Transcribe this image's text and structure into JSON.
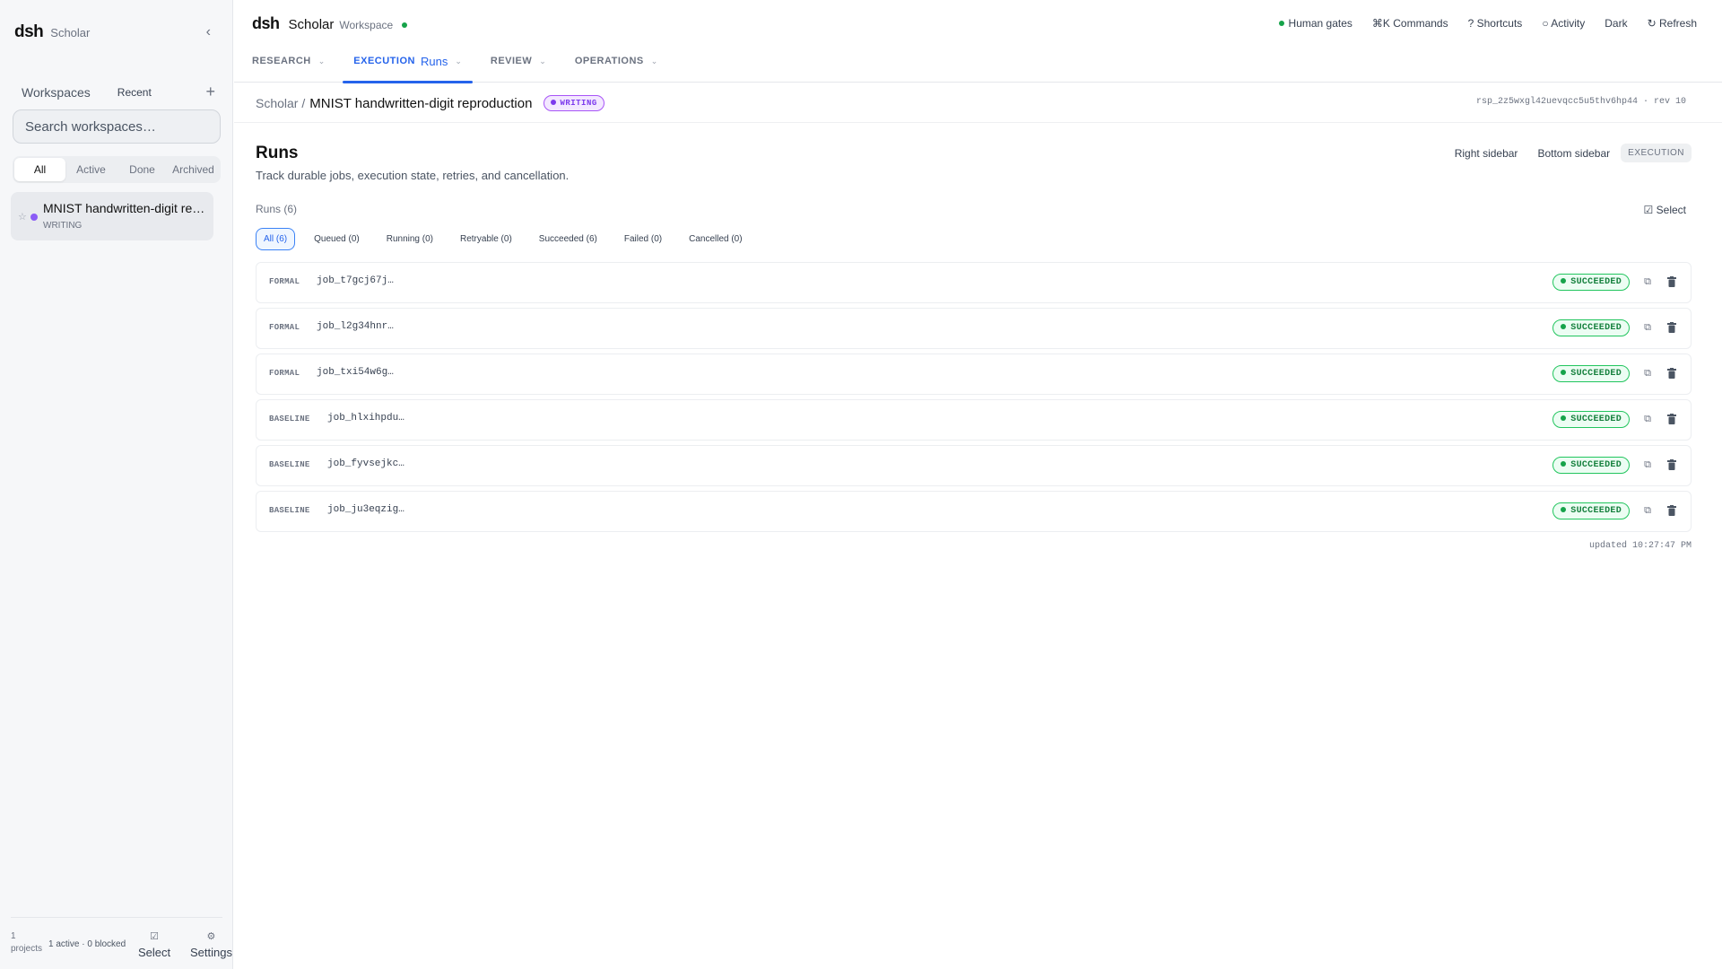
{
  "sidebar": {
    "brand": "dsh",
    "brand_sub": "Scholar",
    "collapse_icon": "‹",
    "workspaces_label": "Workspaces",
    "recent_label": "Recent",
    "add_icon": "+",
    "search_placeholder": "Search workspaces…",
    "filters": [
      "All",
      "Active",
      "Done",
      "Archived"
    ],
    "active_filter": "All",
    "project": {
      "star": "☆",
      "name": "MNIST handwritten-digit reproduction",
      "status": "WRITING",
      "dot_color": "#8b5cf6"
    },
    "footer": {
      "projects_count": "1",
      "projects_label": "projects",
      "status": "1 active · 0 blocked",
      "select_icon": "☑",
      "select_label": "Select",
      "settings_icon": "⚙",
      "settings_label": "Settings"
    }
  },
  "topbar": {
    "brand": "dsh",
    "app": "Scholar",
    "context": "Workspace",
    "actions": {
      "human_gates": "Human gates",
      "commands": "⌘K Commands",
      "shortcuts": "? Shortcuts",
      "activity": "○ Activity",
      "theme": "Dark",
      "refresh": "↻ Refresh"
    },
    "nav": [
      {
        "label": "RESEARCH",
        "sub": ""
      },
      {
        "label": "EXECUTION",
        "sub": "Runs"
      },
      {
        "label": "REVIEW",
        "sub": ""
      },
      {
        "label": "OPERATIONS",
        "sub": ""
      }
    ],
    "chevron": "⌄"
  },
  "crumb": {
    "root": "Scholar /",
    "page": "MNIST handwritten-digit reproduction",
    "badge": "WRITING",
    "id": "rsp_2z5wxgl42uevqcc5u5thv6hp44 · rev 10"
  },
  "main": {
    "title": "Runs",
    "description": "Track durable jobs, execution state, retries, and cancellation.",
    "right_sidebar": "Right sidebar",
    "bottom_sidebar": "Bottom sidebar",
    "section_pill": "EXECUTION",
    "runs_count": "Runs (6)",
    "select": "☑ Select",
    "filters": [
      "All (6)",
      "Queued (0)",
      "Running (0)",
      "Retryable (0)",
      "Succeeded (6)",
      "Failed (0)",
      "Cancelled (0)"
    ],
    "runs": [
      {
        "kind": "FORMAL",
        "id": "job_t7gcj67j…",
        "status": "SUCCEEDED"
      },
      {
        "kind": "FORMAL",
        "id": "job_l2g34hnr…",
        "status": "SUCCEEDED"
      },
      {
        "kind": "FORMAL",
        "id": "job_txi54w6g…",
        "status": "SUCCEEDED"
      },
      {
        "kind": "BASELINE",
        "id": "job_hlxihpdu…",
        "status": "SUCCEEDED"
      },
      {
        "kind": "BASELINE",
        "id": "job_fyvsejkc…",
        "status": "SUCCEEDED"
      },
      {
        "kind": "BASELINE",
        "id": "job_ju3eqzig…",
        "status": "SUCCEEDED"
      }
    ],
    "copy_icon": "⧉",
    "updated": "updated 10:27:47 PM"
  },
  "colors": {
    "accent": "#2563eb",
    "success": "#16a34a",
    "writing": "#7c3aed"
  }
}
